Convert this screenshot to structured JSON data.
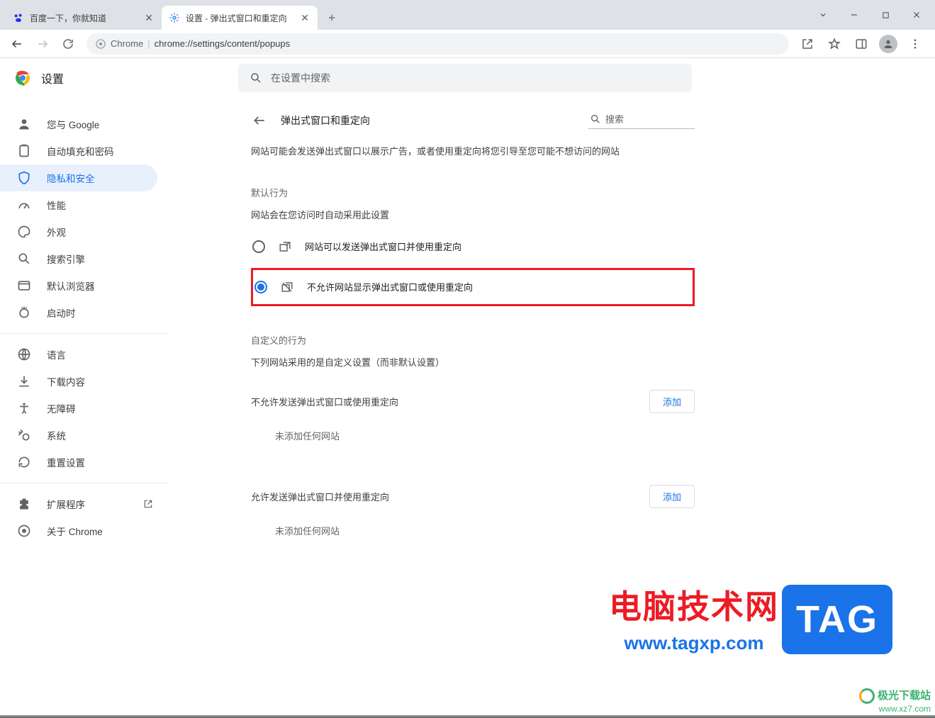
{
  "tabs": {
    "items": [
      {
        "title": "百度一下，你就知道",
        "active": false
      },
      {
        "title": "设置 - 弹出式窗口和重定向",
        "active": true
      }
    ]
  },
  "omnibox": {
    "scheme_label": "Chrome",
    "url": "chrome://settings/content/popups"
  },
  "settings": {
    "app_title": "设置",
    "search_placeholder": "在设置中搜索"
  },
  "sidebar": {
    "items": [
      {
        "label": "您与 Google",
        "key": "you-and-google"
      },
      {
        "label": "自动填充和密码",
        "key": "autofill"
      },
      {
        "label": "隐私和安全",
        "key": "privacy",
        "active": true
      },
      {
        "label": "性能",
        "key": "performance"
      },
      {
        "label": "外观",
        "key": "appearance"
      },
      {
        "label": "搜索引擎",
        "key": "search-engine"
      },
      {
        "label": "默认浏览器",
        "key": "default-browser"
      },
      {
        "label": "启动时",
        "key": "on-startup"
      }
    ],
    "items2": [
      {
        "label": "语言",
        "key": "languages"
      },
      {
        "label": "下载内容",
        "key": "downloads"
      },
      {
        "label": "无障碍",
        "key": "accessibility"
      },
      {
        "label": "系统",
        "key": "system"
      },
      {
        "label": "重置设置",
        "key": "reset"
      }
    ],
    "items3": [
      {
        "label": "扩展程序",
        "key": "extensions",
        "external": true
      },
      {
        "label": "关于 Chrome",
        "key": "about"
      }
    ]
  },
  "panel": {
    "title": "弹出式窗口和重定向",
    "search_placeholder": "搜索",
    "description": "网站可能会发送弹出式窗口以展示广告，或者使用重定向将您引导至您可能不想访问的网站",
    "default_behavior_label": "默认行为",
    "default_behavior_sub": "网站会在您访问时自动采用此设置",
    "radio_allow": "网站可以发送弹出式窗口并使用重定向",
    "radio_block": "不允许网站显示弹出式窗口或使用重定向",
    "custom_label": "自定义的行为",
    "custom_sub": "下列网站采用的是自定义设置（而非默认设置）",
    "block_list_label": "不允许发送弹出式窗口或使用重定向",
    "allow_list_label": "允许发送弹出式窗口并使用重定向",
    "add_button": "添加",
    "empty_text": "未添加任何网站"
  },
  "watermark": {
    "line1": "电脑技术网",
    "line2": "www.tagxp.com",
    "tag": "TAG",
    "wm2_line1": "极光下载站",
    "wm2_line2": "www.xz7.com"
  }
}
